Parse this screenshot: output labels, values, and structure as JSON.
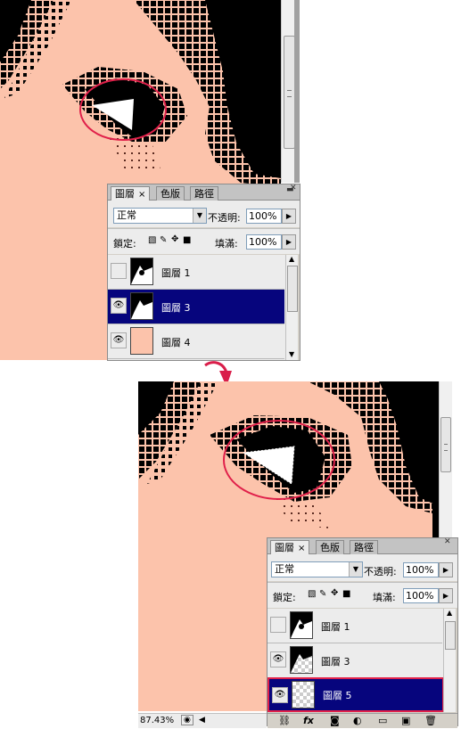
{
  "top": {
    "panel": {
      "tabs": [
        {
          "label": "圖層",
          "close": "×"
        },
        {
          "label": "色版"
        },
        {
          "label": "路徑"
        }
      ],
      "blend_mode": "正常",
      "opacity_label": "不透明:",
      "opacity_value": "100%",
      "lock_label": "鎖定:",
      "fill_label": "填滿:",
      "fill_value": "100%",
      "layers": [
        {
          "name": "圖層 1",
          "visible": false,
          "selected": false
        },
        {
          "name": "圖層 3",
          "visible": true,
          "selected": true
        },
        {
          "name": "圖層 4",
          "visible": true,
          "selected": false
        }
      ]
    }
  },
  "bottom": {
    "panel": {
      "tabs": [
        {
          "label": "圖層",
          "close": "×"
        },
        {
          "label": "色版"
        },
        {
          "label": "路徑"
        }
      ],
      "blend_mode": "正常",
      "opacity_label": "不透明:",
      "opacity_value": "100%",
      "lock_label": "鎖定:",
      "fill_label": "填滿:",
      "fill_value": "100%",
      "layers": [
        {
          "name": "圖層 1",
          "visible": false,
          "selected": false
        },
        {
          "name": "圖層 3",
          "visible": true,
          "selected": false
        },
        {
          "name": "圖層 5",
          "visible": true,
          "selected": true
        }
      ],
      "footer_icons": [
        "link-icon",
        "fx-icon",
        "mask-icon",
        "adjustment-icon",
        "folder-icon",
        "new-layer-icon",
        "trash-icon"
      ]
    },
    "status_zoom": "87.43%"
  },
  "colors": {
    "skin": "#fcc3ab",
    "selection": "#06057d",
    "ellipse": "#e0204a"
  }
}
